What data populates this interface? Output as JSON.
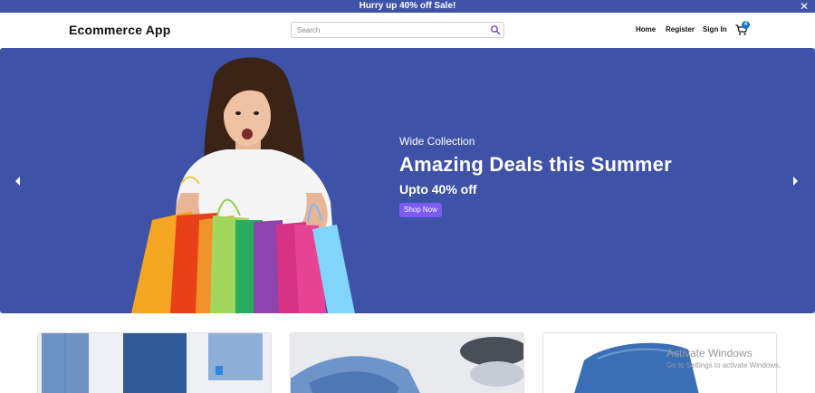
{
  "promo": {
    "text": "Hurry up 40% off Sale!",
    "close_icon": "close-icon"
  },
  "header": {
    "brand": "Ecommerce App",
    "search": {
      "placeholder": "Search",
      "value": "",
      "icon": "search-icon"
    },
    "nav": [
      {
        "label": "Home"
      },
      {
        "label": "Register"
      },
      {
        "label": "Sign In"
      }
    ],
    "cart": {
      "icon": "cart-icon",
      "count": "4"
    }
  },
  "hero": {
    "eyebrow": "Wide Collection",
    "title": "Amazing Deals this Summer",
    "subtitle": "Upto 40% off",
    "cta": "Shop Now",
    "prev_icon": "chevron-left-icon",
    "next_icon": "chevron-right-icon"
  },
  "products": [
    {
      "image": "jeans-stack"
    },
    {
      "image": "jeans-and-sneakers"
    },
    {
      "image": "folded-jeans"
    }
  ],
  "watermark": {
    "title": "Activate Windows",
    "subtitle": "Go to Settings to activate Windows."
  },
  "colors": {
    "brand_blue": "#3e52a8",
    "accent_purple": "#7b5cf0",
    "badge_blue": "#1976d2"
  }
}
